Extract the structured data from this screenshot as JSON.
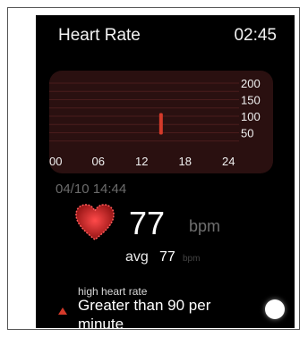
{
  "header": {
    "title": "Heart Rate",
    "time": "02:45"
  },
  "chart_data": {
    "type": "bar",
    "x_ticks": [
      "00",
      "06",
      "12",
      "18",
      "24"
    ],
    "y_ticks": [
      "200",
      "150",
      "100",
      "50"
    ],
    "xlim": [
      0,
      24
    ],
    "ylim": [
      0,
      200
    ],
    "points": [
      {
        "x": 14.7,
        "y": 77
      }
    ],
    "bar_color": "#d43a2a"
  },
  "reading": {
    "timestamp": "04/10 14:44",
    "value": "77",
    "unit": "bpm",
    "avg_label": "avg",
    "avg_value": "77",
    "avg_unit": "bpm"
  },
  "alert": {
    "title": "high heart rate",
    "text": "Greater than 90 per minute"
  },
  "colors": {
    "accent": "#d43a2a",
    "panel": "#2a1010"
  },
  "icons": {
    "heart": "heart-icon",
    "alert": "triangle-up-icon",
    "scroll": "scroll-indicator"
  }
}
